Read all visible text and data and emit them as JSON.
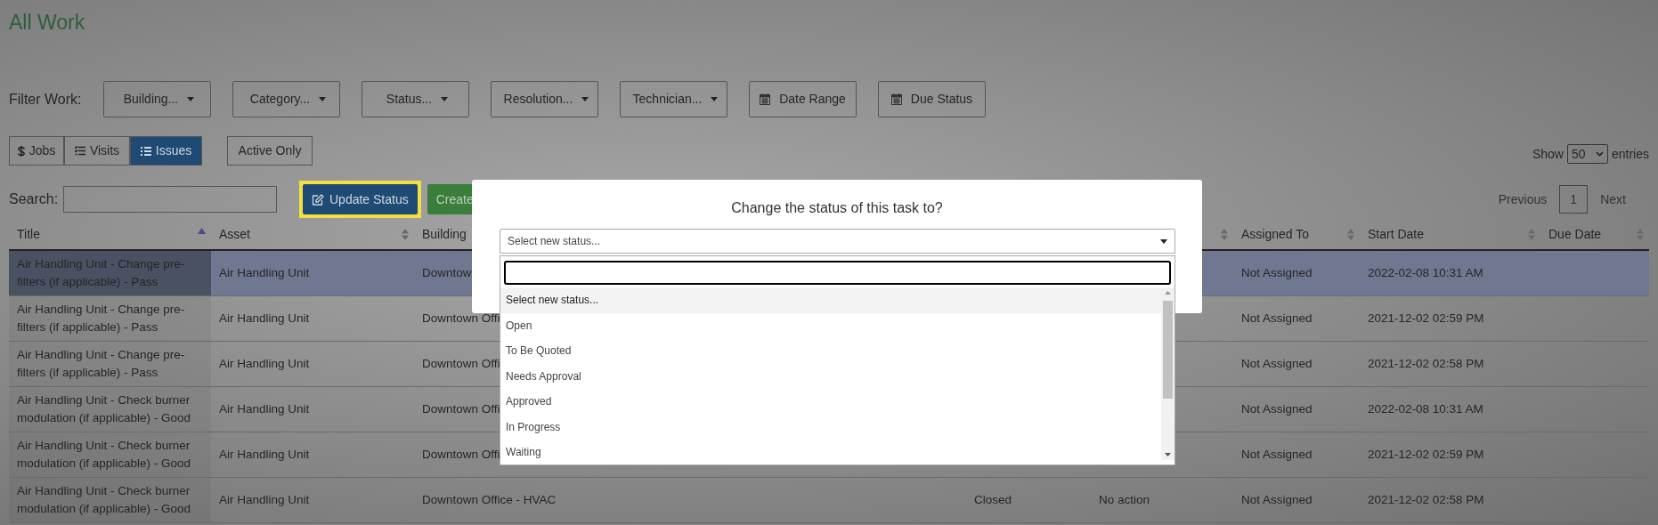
{
  "page_title": "All Work",
  "filters": {
    "label": "Filter Work:",
    "items": [
      {
        "kind": "dropdown",
        "label": "Building..."
      },
      {
        "kind": "dropdown",
        "label": "Category..."
      },
      {
        "kind": "dropdown",
        "label": "Status..."
      },
      {
        "kind": "dropdown",
        "label": "Resolution..."
      },
      {
        "kind": "dropdown",
        "label": "Technician..."
      },
      {
        "kind": "date",
        "label": "Date Range"
      },
      {
        "kind": "date",
        "label": "Due Status"
      }
    ]
  },
  "view_tabs": [
    {
      "label": "Jobs",
      "selected": false
    },
    {
      "label": "Visits",
      "selected": false
    },
    {
      "label": "Issues",
      "selected": true
    }
  ],
  "active_only": {
    "label": "Active Only"
  },
  "show_entries": {
    "prefix": "Show",
    "value": "50",
    "suffix": "entries"
  },
  "search": {
    "label": "Search:"
  },
  "actions": [
    {
      "kind": "primary",
      "label": "Update Status",
      "highlighted": true
    },
    {
      "kind": "success",
      "label": "Create",
      "highlighted": false
    }
  ],
  "pagination": {
    "previous": "Previous",
    "pages": [
      {
        "label": "1",
        "selected": true
      }
    ],
    "next": "Next"
  },
  "table": {
    "columns": [
      {
        "label": "Title",
        "sorted": true
      },
      {
        "label": "Asset",
        "sorted": false
      },
      {
        "label": "Building"
      },
      {},
      {
        "sorted": false
      },
      {
        "label": "Assigned To",
        "sorted": false
      },
      {
        "label": "Start Date",
        "sorted": false
      },
      {
        "label": "Due Date",
        "sorted": false
      }
    ],
    "rows": [
      {
        "selected": true,
        "title": "Air Handling Unit - Change pre-filters (if applicable) - Pass",
        "asset": "Air Handling Unit",
        "building": "Downtow",
        "assigned_to": "Not Assigned",
        "start_date": "2022-02-08 10:31 AM"
      },
      {
        "selected": false,
        "title": "Air Handling Unit - Change pre-filters (if applicable) - Pass",
        "asset": "Air Handling Unit",
        "building": "Downtown Offi",
        "assigned_to": "Not Assigned",
        "start_date": "2021-12-02 02:59 PM"
      },
      {
        "selected": false,
        "title": "Air Handling Unit - Change pre-filters (if applicable) - Pass",
        "asset": "Air Handling Unit",
        "building": "Downtown Offi",
        "assigned_to": "Not Assigned",
        "start_date": "2021-12-02 02:58 PM"
      },
      {
        "selected": false,
        "title": "Air Handling Unit - Check burner modulation (if applicable) - Good",
        "asset": "Air Handling Unit",
        "building": "Downtown Offi",
        "assigned_to": "Not Assigned",
        "start_date": "2022-02-08 10:31 AM"
      },
      {
        "selected": false,
        "title": "Air Handling Unit - Check burner modulation (if applicable) - Good",
        "asset": "Air Handling Unit",
        "building": "Downtown Offi",
        "assigned_to": "Not Assigned",
        "start_date": "2021-12-02 02:59 PM"
      },
      {
        "selected": false,
        "title": "Air Handling Unit - Check burner modulation (if applicable) - Good",
        "asset": "Air Handling Unit",
        "building": "Downtown Office - HVAC",
        "column_4": "Closed",
        "column_5": "No action",
        "assigned_to": "Not Assigned",
        "start_date": "2021-12-02 02:58 PM"
      }
    ]
  },
  "modal": {
    "title": "Change the status of this task to?",
    "select": {
      "value": "Select new status...",
      "expanded": true
    },
    "options": [
      {
        "label": "Select new status...",
        "selected": true
      },
      {
        "label": "Open",
        "selected": false
      },
      {
        "label": "To Be Quoted",
        "selected": false
      },
      {
        "label": "Needs Approval",
        "selected": false
      },
      {
        "label": "Approved",
        "selected": false
      },
      {
        "label": "In Progress",
        "selected": false
      },
      {
        "label": "Waiting",
        "selected": false
      }
    ]
  }
}
